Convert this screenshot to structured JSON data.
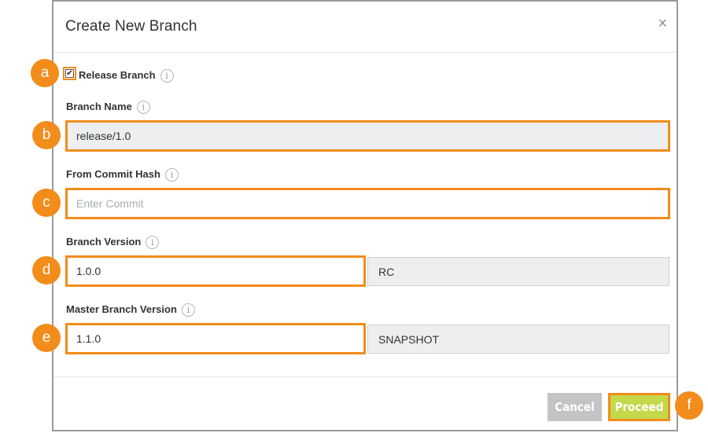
{
  "dialog": {
    "title": "Create New Branch",
    "close_label": "×"
  },
  "release_branch": {
    "label": "Release Branch",
    "checked": true,
    "check_glyph": "✔"
  },
  "branch_name": {
    "label": "Branch Name",
    "value": "release/1.0"
  },
  "commit_hash": {
    "label": "From Commit Hash",
    "placeholder": "Enter Commit"
  },
  "branch_version": {
    "label": "Branch Version",
    "value": "1.0.0",
    "suffix": "RC"
  },
  "master_branch_version": {
    "label": "Master Branch Version",
    "value": "1.1.0",
    "suffix": "SNAPSHOT"
  },
  "footer": {
    "cancel_label": "Cancel",
    "proceed_label": "Proceed"
  },
  "info_glyph": "i",
  "markers": {
    "a": "a",
    "b": "b",
    "c": "c",
    "d": "d",
    "e": "e",
    "f": "f"
  },
  "colors": {
    "highlight": "#f28c1b",
    "proceed": "#c3d94a",
    "cancel": "#c4c4c4",
    "readonly_bg": "#eceeef"
  }
}
